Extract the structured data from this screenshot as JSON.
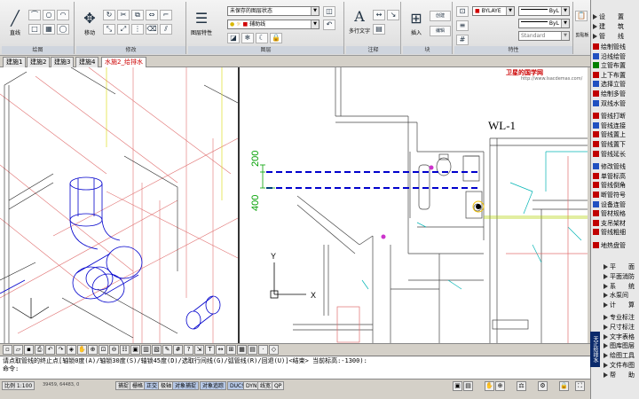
{
  "ribbon": {
    "groups": [
      {
        "label": "绘图"
      },
      {
        "label": "修改"
      },
      {
        "label": "图层"
      },
      {
        "label": "注释"
      },
      {
        "label": "块"
      },
      {
        "label": "特性"
      }
    ],
    "draw_big_label": "直线",
    "modify_big_label": "移动",
    "layer_combo": "未保存的图层状态",
    "layer_name": "辅助线",
    "layer_props_label": "图层特性",
    "text_big_label": "多行文字",
    "text_big_glyph": "A",
    "insert_label": "插入",
    "create_label": "创建",
    "edit_label": "编辑",
    "color_combo": "BYLAYE",
    "linetype_combo": "ByL",
    "lineweight_combo": "ByL",
    "annot_combo": "Standard",
    "color_label": "颜色",
    "clip_label": "剪贴板"
  },
  "tabs": [
    "建施1",
    "建施2",
    "建施3",
    "建施4",
    "水施2_给排水"
  ],
  "canvas": {
    "banner": "卫星的国学网",
    "banner_url": "http://www.lsacdemas.com/",
    "label_wl": "WL-1",
    "dim_200": "200",
    "dim_400": "400",
    "axis_y": "Y",
    "axis_x": "X"
  },
  "command": {
    "line1": "请点取管线的终止点[轴锁0度(A)/轴锁30度(S)/轴锁45度(D)/选取行间线(G)/弧管线(R)/回退(U)]<结束> 当前标高:-1300):",
    "line2": "命令:"
  },
  "status": {
    "scale": "比例 1:100",
    "coords": "39459, 64483, 0",
    "buttons": [
      "捕捉",
      "栅格",
      "正交",
      "极轴",
      "对象捕捉",
      "对象追踪",
      "DUCS",
      "DYN",
      "线宽",
      "QP"
    ],
    "active": [
      "正交",
      "对象捕捉",
      "对象追踪",
      "DUCS"
    ]
  },
  "right_panel": {
    "top_items": [
      "设　　置",
      "建　　筑",
      "管　　线"
    ],
    "items": [
      "绘制管线",
      "沿线绘管",
      "立管布置",
      "上下布置",
      "选择立管",
      "绘制多管",
      "双线水管",
      "管线打断",
      "管线连接",
      "管线置上",
      "管线置下",
      "管线延长",
      "修改管线",
      "单管标高",
      "管线倒角",
      "断管符号",
      "设备连管",
      "管材规格",
      "支吊架材",
      "管线粗细",
      "地热盘管"
    ],
    "bottom_items": [
      "平　　面",
      "平面消防",
      "系　　统",
      "水泵间",
      "计　　算",
      "专业标注",
      "尺寸标注",
      "文字表格",
      "图库图层",
      "绘图工具",
      "文件布图",
      "帮　　助"
    ],
    "vtitle": "天正给排水"
  },
  "colors": {
    "pipe_blue": "#0000cc",
    "dim_green": "#00a000",
    "wall_gray": "#444444",
    "iso_red": "#e07070",
    "accent_red": "#cc0000"
  }
}
